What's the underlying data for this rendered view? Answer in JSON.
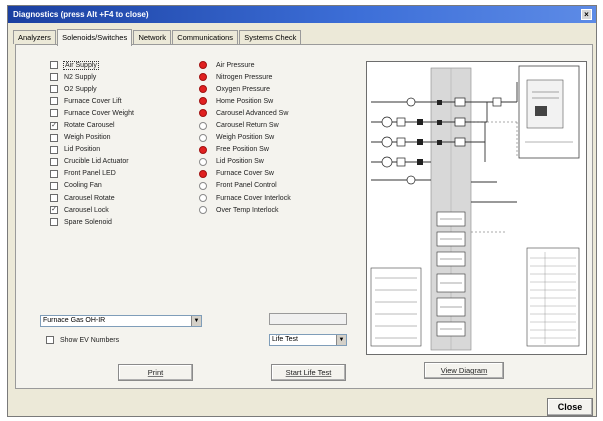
{
  "window": {
    "title": "Diagnostics (press Alt +F4 to close)",
    "close_glyph": "×"
  },
  "tabs": [
    {
      "label": "Analyzers",
      "active": false
    },
    {
      "label": "Solenoids/Switches",
      "active": true
    },
    {
      "label": "Network",
      "active": false
    },
    {
      "label": "Communications",
      "active": false
    },
    {
      "label": "Systems Check",
      "active": false
    }
  ],
  "solenoids": [
    {
      "label": "Air Supply",
      "checked": false
    },
    {
      "label": "N2 Supply",
      "checked": false
    },
    {
      "label": "O2 Supply",
      "checked": false
    },
    {
      "label": "Furnace Cover Lift",
      "checked": false
    },
    {
      "label": "Furnace Cover Weight",
      "checked": false
    },
    {
      "label": "Rotate Carousel",
      "checked": true
    },
    {
      "label": "Weigh Position",
      "checked": false
    },
    {
      "label": "Lid Position",
      "checked": false
    },
    {
      "label": "Crucible Lid Actuator",
      "checked": false
    },
    {
      "label": "Front Panel LED",
      "checked": false
    },
    {
      "label": "Cooling Fan",
      "checked": false
    },
    {
      "label": "Carousel Rotate",
      "checked": false
    },
    {
      "label": "Carousel Lock",
      "checked": true
    },
    {
      "label": "Spare Solenoid",
      "checked": false
    }
  ],
  "switches": [
    {
      "label": "Air Pressure",
      "active": true
    },
    {
      "label": "Nitrogen Pressure",
      "active": true
    },
    {
      "label": "Oxygen Pressure",
      "active": true
    },
    {
      "label": "Home Position Sw",
      "active": true
    },
    {
      "label": "Carousel Advanced Sw",
      "active": true
    },
    {
      "label": "Carousel Return Sw",
      "active": false
    },
    {
      "label": "Weigh Position Sw",
      "active": false
    },
    {
      "label": "Free Position Sw",
      "active": true
    },
    {
      "label": "Lid Position Sw",
      "active": false
    },
    {
      "label": "Furnace Cover Sw",
      "active": true
    },
    {
      "label": "Front Panel Control",
      "active": false
    },
    {
      "label": "Furnace Cover Interlock",
      "active": false
    },
    {
      "label": "Over Temp Interlock",
      "active": false
    }
  ],
  "device_select": {
    "value": "Furnace Gas OH-IR"
  },
  "show_ev_numbers": {
    "label": "Show EV Numbers",
    "checked": false
  },
  "life_test": {
    "textbox_value": "",
    "select_value": "Life Test"
  },
  "buttons": {
    "print": "Print",
    "start_life_test": "Start Life Test",
    "view_diagram": "View Diagram",
    "close": "Close"
  },
  "colors": {
    "title_start": "#1a3fa0",
    "title_end": "#5d8be6",
    "panel_bg": "#f4f3ee",
    "window_bg": "#ece9d8",
    "active_indicator": "#e02020"
  },
  "icons": {
    "combo_arrow": "▼",
    "check_mark": "✓"
  }
}
